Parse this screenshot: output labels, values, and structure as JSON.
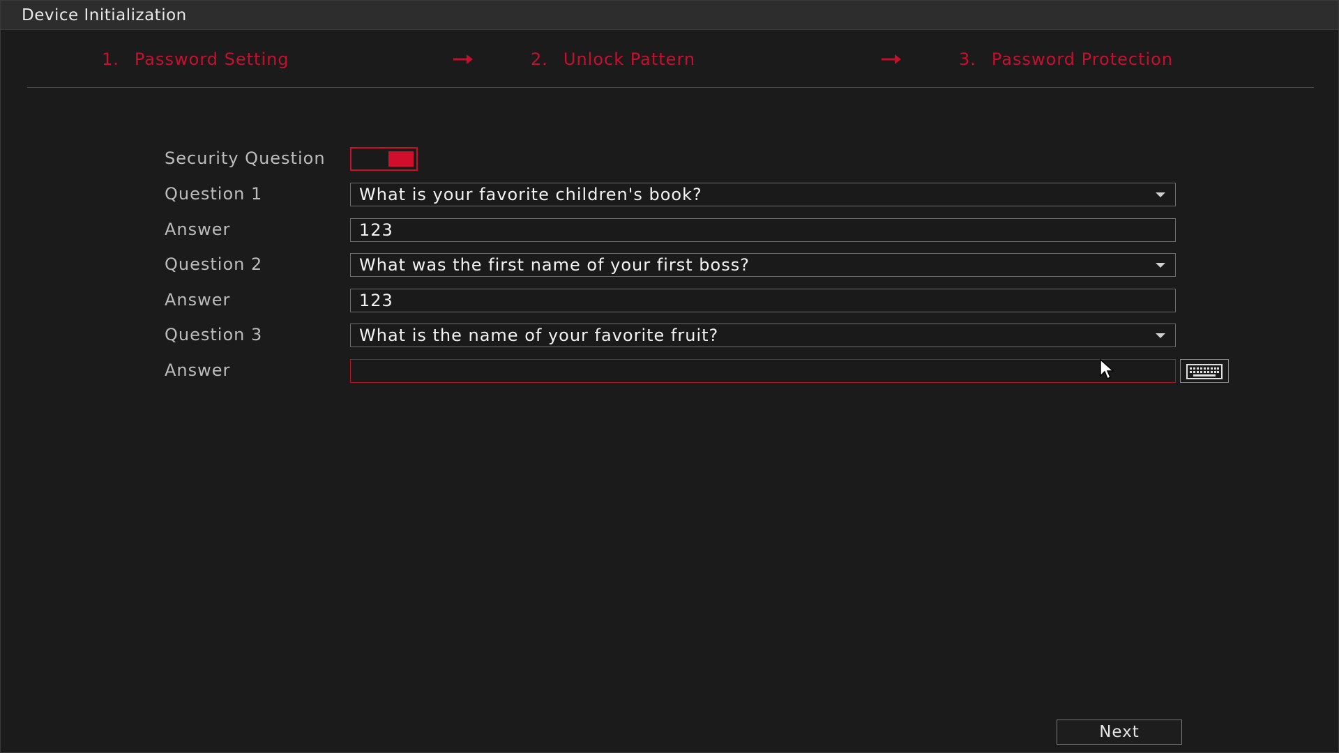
{
  "window": {
    "title": "Device Initialization"
  },
  "steps": [
    {
      "num": "1.",
      "label": "Password Setting"
    },
    {
      "num": "2.",
      "label": "Unlock Pattern"
    },
    {
      "num": "3.",
      "label": "Password Protection"
    }
  ],
  "form": {
    "security_question": {
      "label": "Security Question",
      "enabled": true
    },
    "question1": {
      "label": "Question 1",
      "value": "What is your favorite children's book?"
    },
    "answer1": {
      "label": "Answer",
      "value": "123"
    },
    "question2": {
      "label": "Question 2",
      "value": "What was the first name of your first boss?"
    },
    "answer2": {
      "label": "Answer",
      "value": "123"
    },
    "question3": {
      "label": "Question 3",
      "value": "What is the name of your favorite fruit?"
    },
    "answer3": {
      "label": "Answer",
      "value": ""
    }
  },
  "footer": {
    "next_label": "Next"
  },
  "icons": {
    "step_arrow": "arrow-right-icon",
    "keyboard": "keyboard-icon",
    "dropdown": "chevron-down-icon",
    "cursor": "mouse-pointer-icon"
  },
  "colors": {
    "accent": "#c8102e",
    "background": "#1b1b1b",
    "titlebar": "#2d2d2d"
  }
}
